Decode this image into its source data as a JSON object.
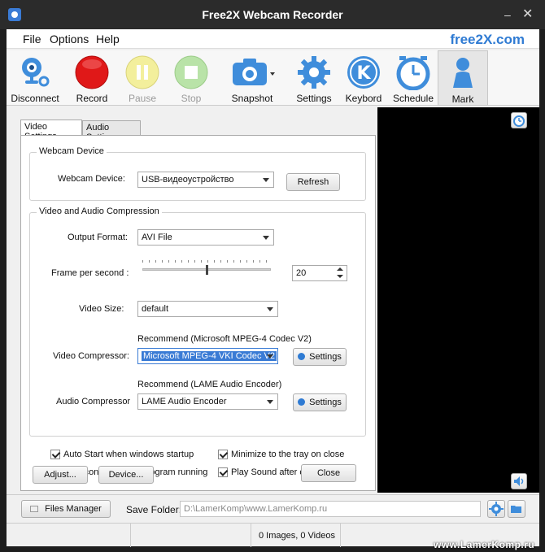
{
  "window": {
    "title": "Free2X Webcam Recorder",
    "minimize": "–",
    "close": "✕"
  },
  "menu": {
    "items": [
      "File",
      "Options",
      "Help"
    ],
    "brand": "free2X.com"
  },
  "toolbar": {
    "disconnect": "Disconnect",
    "record": "Record",
    "pause": "Pause",
    "stop": "Stop",
    "snapshot": "Snapshot",
    "settings": "Settings",
    "keyboard": "Keybord",
    "schedule": "Schedule",
    "mark": "Mark"
  },
  "tabs": [
    "Video Settings",
    "Audio Settings"
  ],
  "webcam": {
    "group_title": "Webcam Device",
    "device_label": "Webcam Device:",
    "device_value": "USB-видеоустройство",
    "refresh": "Refresh"
  },
  "compression": {
    "group_title": "Video and Audio Compression",
    "output_format_label": "Output Format:",
    "output_format_value": "AVI File",
    "fps_label": "Frame per second :",
    "fps_value": "20",
    "fps_slider_fraction": 0.5,
    "video_size_label": "Video Size:",
    "video_size_value": "default",
    "video_recommend": "Recommend (Microsoft MPEG-4 Codec V2)",
    "video_compressor_label": "Video Compressor:",
    "video_compressor_value": "Microsoft MPEG-4  VKI  Codec V2",
    "audio_recommend": "Recommend (LAME Audio Encoder)",
    "audio_compressor_label": "Audio Compressor",
    "audio_compressor_value": "LAME Audio Encoder",
    "settings": "Settings"
  },
  "options": {
    "auto_start": "Auto Start when windows startup",
    "auto_start_checked": true,
    "auto_connect": "Auto connect when program running",
    "auto_connect_checked": false,
    "minimize_tray": "Minimize to the tray on close",
    "minimize_tray_checked": true,
    "play_sound": "Play Sound after capture",
    "play_sound_checked": true
  },
  "buttons": {
    "adjust": "Adjust...",
    "device": "Device...",
    "close": "Close"
  },
  "bottom": {
    "files_manager": "Files Manager",
    "save_folder_label": "Save Folder:",
    "save_folder_value": "D:\\LamerKomp\\www.LamerKomp.ru"
  },
  "status": {
    "counts": "0 Images, 0 Videos"
  },
  "watermark": "www.LamerKomp.ru",
  "colors": {
    "accent": "#2f7bd3",
    "record": "#e01818",
    "titlebar": "#2b2b2b"
  }
}
